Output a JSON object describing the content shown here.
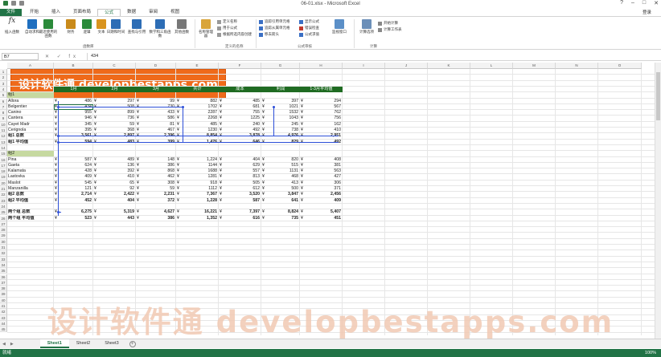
{
  "window": {
    "title": "06-01.xlsx - Microsoft Excel",
    "login": "登录"
  },
  "tabs": [
    "文件",
    "开始",
    "插入",
    "页面布局",
    "公式",
    "数据",
    "审阅",
    "视图"
  ],
  "ribbon": {
    "library": [
      "插入函数",
      "自动求和",
      "最近使用的函数",
      "财务",
      "逻辑",
      "文本",
      "日期和时间",
      "查找与引用",
      "数学和三角函数",
      "其他函数"
    ],
    "library_label": "函数库",
    "names": [
      "名称管理器",
      "定义名称",
      "用于公式",
      "根据所选内容创建"
    ],
    "names_label": "定义的名称",
    "audit": [
      "追踪引用单元格",
      "追踪从属单元格",
      "移去箭头",
      "显示公式",
      "错误检查",
      "公式求值",
      "监视窗口"
    ],
    "audit_label": "公式审核",
    "calc": [
      "计算选项",
      "开始计算",
      "计算工作表"
    ],
    "calc_label": "计算"
  },
  "formula": {
    "namebox": "B7",
    "fx": "✕ ✓ fx",
    "value": "434"
  },
  "columns": [
    "A",
    "B",
    "C",
    "D",
    "E",
    "F",
    "G",
    "H",
    "I",
    "J",
    "K",
    "L",
    "M",
    "N",
    "O"
  ],
  "banner": "设计软件通 developbestapps.com",
  "headers": [
    "1月",
    "2月",
    "3月",
    "共计",
    "成本",
    "利润",
    "1-3月平均值"
  ],
  "rows": [
    {
      "r": "5",
      "a": "组1",
      "g": true
    },
    {
      "r": "6",
      "a": "Allora",
      "v": [
        "486",
        "297",
        "99",
        "882",
        "485",
        "397",
        "294"
      ]
    },
    {
      "r": "7",
      "a": "Belgentier",
      "v": [
        "434",
        "508",
        "730",
        "1702",
        "681",
        "1021",
        "567"
      ]
    },
    {
      "r": "8",
      "a": "Canino",
      "v": [
        "955",
        "899",
        "433",
        "2287",
        "755",
        "1532",
        "762"
      ]
    },
    {
      "r": "9",
      "a": "Cantera",
      "v": [
        "946",
        "736",
        "586",
        "2268",
        "1225",
        "1043",
        "756"
      ]
    },
    {
      "r": "10",
      "a": "Cayet Madr",
      "v": [
        "345",
        "59",
        "81",
        "485",
        "240",
        "245",
        "162"
      ]
    },
    {
      "r": "11",
      "a": "Cerignola",
      "v": [
        "395",
        "368",
        "467",
        "1230",
        "492",
        "738",
        "410"
      ]
    },
    {
      "r": "12",
      "a": "组1 总数",
      "b": true,
      "v": [
        "3,561",
        "2,897",
        "2,396",
        "8,854",
        "3,878",
        "4,976",
        "2,951"
      ]
    },
    {
      "r": "13",
      "a": "组1 平均值",
      "b": true,
      "v": [
        "594",
        "483",
        "399",
        "1,476",
        "646",
        "829",
        "492"
      ]
    },
    {
      "r": "14",
      "a": ""
    },
    {
      "r": "15",
      "a": "组2",
      "g": true
    },
    {
      "r": "16",
      "a": "Pina",
      "v": [
        "587",
        "489",
        "148",
        "1,224",
        "404",
        "820",
        "408"
      ]
    },
    {
      "r": "17",
      "a": "Gaeta",
      "v": [
        "624",
        "136",
        "386",
        "1144",
        "629",
        "515",
        "381"
      ]
    },
    {
      "r": "18",
      "a": "Kalamata",
      "v": [
        "428",
        "392",
        "868",
        "1688",
        "557",
        "1131",
        "563"
      ]
    },
    {
      "r": "19",
      "a": "Lastovka",
      "v": [
        "409",
        "410",
        "462",
        "1281",
        "813",
        "468",
        "427"
      ]
    },
    {
      "r": "20",
      "a": "Maslot",
      "v": [
        "545",
        "65",
        "308",
        "918",
        "505",
        "413",
        "306"
      ]
    },
    {
      "r": "21",
      "a": "Manzanilla",
      "v": [
        "121",
        "92",
        "59",
        "1112",
        "612",
        "500",
        "371"
      ]
    },
    {
      "r": "22",
      "a": "组2 总数",
      "b": true,
      "v": [
        "2,714",
        "2,422",
        "2,231",
        "7,367",
        "3,520",
        "3,847",
        "2,456"
      ]
    },
    {
      "r": "23",
      "a": "组2 平均值",
      "b": true,
      "v": [
        "452",
        "404",
        "372",
        "1,228",
        "587",
        "641",
        "409"
      ]
    },
    {
      "r": "24",
      "a": ""
    },
    {
      "r": "25",
      "a": "两个组 总数",
      "b": true,
      "v": [
        "6,275",
        "5,319",
        "4,627",
        "16,221",
        "7,397",
        "8,824",
        "5,407"
      ]
    },
    {
      "r": "26",
      "a": "两个组 平均值",
      "b": true,
      "v": [
        "523",
        "443",
        "386",
        "1,352",
        "616",
        "735",
        "451"
      ]
    }
  ],
  "watermark": "设计软件通 developbestapps.com",
  "sheets": [
    "Sheet1",
    "Sheet2",
    "Sheet3"
  ],
  "status": {
    "text": "就绪",
    "zoom": "100%"
  }
}
